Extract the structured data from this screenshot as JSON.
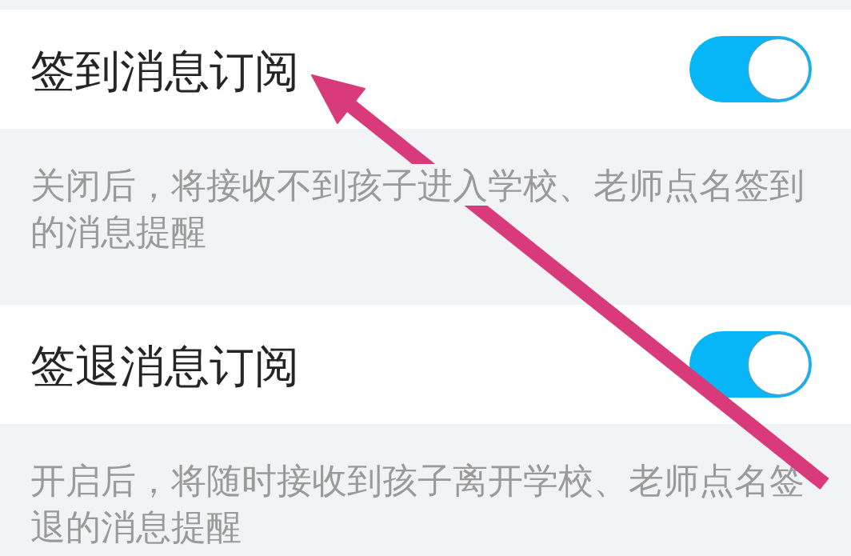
{
  "settings": [
    {
      "title": "签到消息订阅",
      "on": true,
      "description": "关闭后，将接收不到孩子进入学校、老师点名签到的消息提醒"
    },
    {
      "title": "签退消息订阅",
      "on": true,
      "description": "开启后，将随时接收到孩子离开学校、老师点名签退的消息提醒"
    }
  ]
}
